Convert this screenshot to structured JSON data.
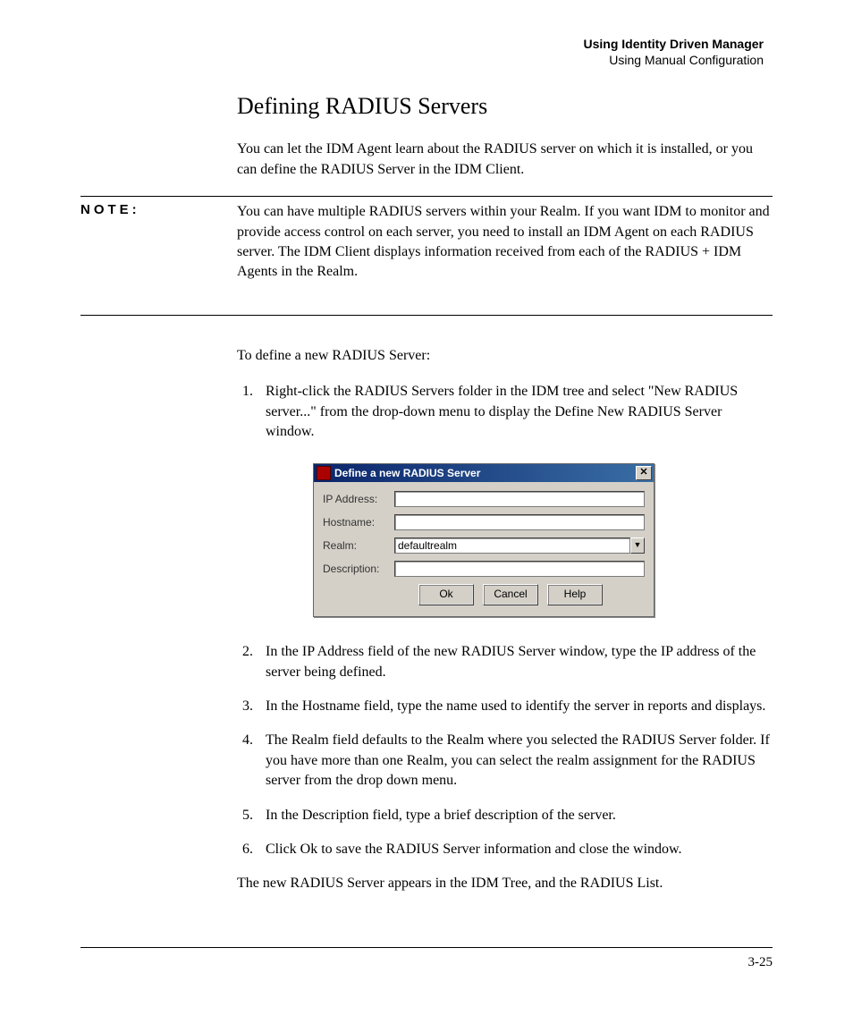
{
  "header": {
    "line1": "Using Identity Driven Manager",
    "line2": "Using Manual Configuration"
  },
  "title": "Defining RADIUS Servers",
  "intro": "You can let the IDM Agent learn about the RADIUS server on which it is installed, or you can define the RADIUS Server in the IDM Client.",
  "note_label": "NOTE:",
  "note_body": "You can have multiple RADIUS servers within your Realm. If you want IDM to monitor and provide access control on each server, you need to install an IDM Agent on each RADIUS server. The IDM Client displays information received from each of the RADIUS + IDM Agents in the Realm.",
  "lead": "To define a new RADIUS Server:",
  "steps_a": [
    "Right-click the RADIUS Servers folder in the IDM tree and select \"New RADIUS server...\" from the drop-down menu to display the Define New RADIUS Server window."
  ],
  "dialog": {
    "title": "Define a new RADIUS Server",
    "close_glyph": "✕",
    "labels": {
      "ip": "IP Address:",
      "host": "Hostname:",
      "realm": "Realm:",
      "desc": "Description:"
    },
    "values": {
      "ip": "",
      "host": "",
      "realm": "defaultrealm",
      "desc": ""
    },
    "dropdown_glyph": "▼",
    "buttons": {
      "ok": "Ok",
      "cancel": "Cancel",
      "help": "Help"
    }
  },
  "steps_b": [
    "In the IP Address field of the new RADIUS Server window, type the IP address of the server being defined.",
    "In the Hostname field, type the name used to identify the server in reports and displays.",
    "The Realm field defaults to the Realm where you selected the RADIUS Server folder. If you have more than one Realm, you can select the realm assignment for the RADIUS server from the drop down menu.",
    "In the Description field, type a brief description of the server.",
    "Click Ok to save the RADIUS Server information and close the window."
  ],
  "closing": "The new RADIUS Server appears in the IDM Tree, and the RADIUS List.",
  "page_number": "3-25"
}
